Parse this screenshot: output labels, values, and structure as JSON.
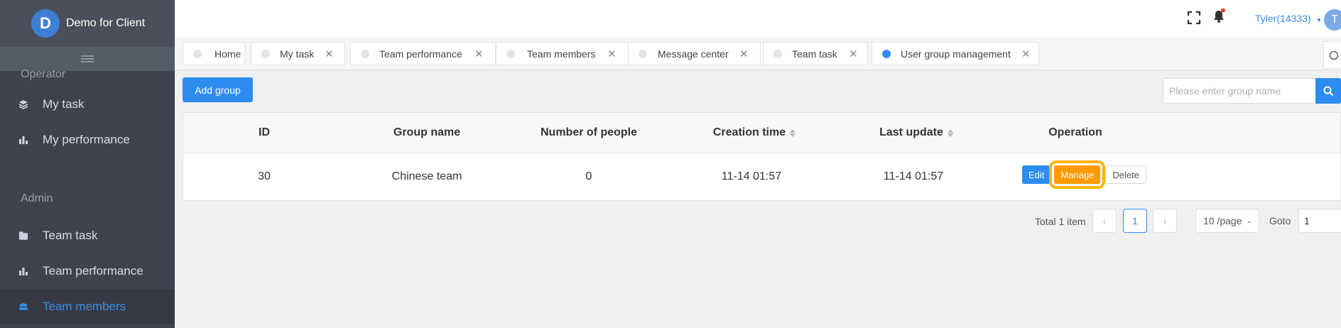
{
  "app": {
    "logo_letter": "D",
    "title": "Demo for Client"
  },
  "sidebar": {
    "sections": [
      {
        "label": "Operator",
        "items": [
          {
            "label": "My task",
            "icon": "layers-icon"
          },
          {
            "label": "My performance",
            "icon": "bar-chart-icon"
          }
        ]
      },
      {
        "label": "Admin",
        "items": [
          {
            "label": "Team task",
            "icon": "folder-icon"
          },
          {
            "label": "Team performance",
            "icon": "bar-chart-icon"
          },
          {
            "label": "Team members",
            "icon": "people-icon",
            "active": true
          }
        ]
      }
    ]
  },
  "topbar": {
    "user": "Tyler(14333)",
    "avatar_letter": "T",
    "icons": [
      "fullscreen-icon",
      "bell-icon"
    ]
  },
  "tabs": [
    {
      "label": "Home",
      "closable": false
    },
    {
      "label": "My task",
      "closable": true
    },
    {
      "label": "Team performance",
      "closable": true
    },
    {
      "label": "Team members",
      "closable": true
    },
    {
      "label": "Message center",
      "closable": true
    },
    {
      "label": "Team task",
      "closable": true
    },
    {
      "label": "User group management",
      "closable": true,
      "active": true
    }
  ],
  "toolbar": {
    "add_label": "Add group",
    "search_placeholder": "Please enter group name"
  },
  "table": {
    "columns": [
      "ID",
      "Group name",
      "Number of people",
      "Creation time",
      "Last update",
      "Operation"
    ],
    "rows": [
      {
        "id": "30",
        "name": "Chinese team",
        "people": "0",
        "created": "11-14 01:57",
        "updated": "11-14 01:57"
      }
    ],
    "actions": {
      "edit": "Edit",
      "manage": "Manage",
      "delete": "Delete"
    }
  },
  "pagination": {
    "total": "Total 1 item",
    "current": "1",
    "page_size": "10 /page",
    "goto_label": "Goto",
    "goto_value": "1"
  },
  "colors": {
    "primary": "#2d8cf0",
    "sidebar": "#3f434f",
    "manage": "#ff9900",
    "highlight": "#ffb400"
  }
}
